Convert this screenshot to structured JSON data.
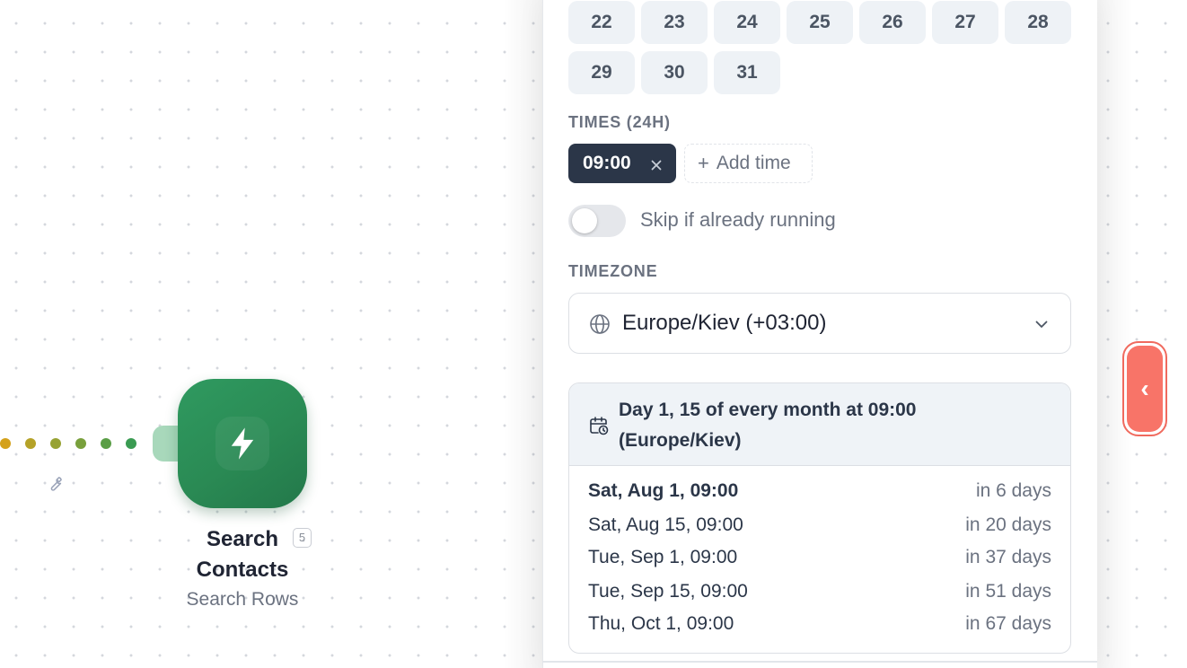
{
  "calendar": {
    "days_row1": [
      "22",
      "23",
      "24",
      "25",
      "26",
      "27",
      "28"
    ],
    "days_row2": [
      "29",
      "30",
      "31"
    ]
  },
  "times": {
    "label": "TIMES (24H)",
    "chips": [
      "09:00"
    ],
    "add_label": "Add time"
  },
  "skip_toggle": {
    "label": "Skip if already running",
    "enabled": false
  },
  "timezone": {
    "label": "TIMEZONE",
    "value": "Europe/Kiev (+03:00)"
  },
  "preview": {
    "summary": "Day 1, 15 of every month at 09:00 (Europe/Kiev)",
    "runs": [
      {
        "when": "Sat, Aug 1, 09:00",
        "relative": "in 6 days"
      },
      {
        "when": "Sat, Aug 15, 09:00",
        "relative": "in 20 days"
      },
      {
        "when": "Tue, Sep 1, 09:00",
        "relative": "in 37 days"
      },
      {
        "when": "Tue, Sep 15, 09:00",
        "relative": "in 51 days"
      },
      {
        "when": "Thu, Oct 1, 09:00",
        "relative": "in 67 days"
      }
    ]
  },
  "node": {
    "title_line1": "Search",
    "title_line2": "Contacts",
    "subtitle": "Search Rows",
    "badge": "5",
    "icon": "lightning-bolt-icon",
    "color": "#2a8a54"
  },
  "connector": {
    "dot_colors": [
      "#d4a11c",
      "#b5a228",
      "#97a233",
      "#79a03c",
      "#5a9e46",
      "#3a9b52"
    ]
  },
  "collapse_button": {
    "label": "‹",
    "color": "#f87468"
  }
}
